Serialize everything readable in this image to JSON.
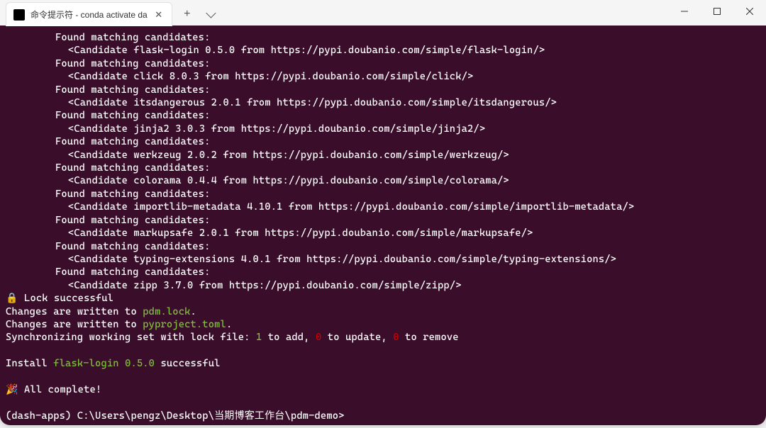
{
  "window": {
    "tab_title": "命令提示符 - conda  activate da",
    "tab_icon_text": "C:\\"
  },
  "terminal": {
    "candidates": [
      {
        "header": "Found matching candidates:",
        "line": "<Candidate flask-login 0.5.0 from https://pypi.doubanio.com/simple/flask-login/>"
      },
      {
        "header": "Found matching candidates:",
        "line": "<Candidate click 8.0.3 from https://pypi.doubanio.com/simple/click/>"
      },
      {
        "header": "Found matching candidates:",
        "line": "<Candidate itsdangerous 2.0.1 from https://pypi.doubanio.com/simple/itsdangerous/>"
      },
      {
        "header": "Found matching candidates:",
        "line": "<Candidate jinja2 3.0.3 from https://pypi.doubanio.com/simple/jinja2/>"
      },
      {
        "header": "Found matching candidates:",
        "line": "<Candidate werkzeug 2.0.2 from https://pypi.doubanio.com/simple/werkzeug/>"
      },
      {
        "header": "Found matching candidates:",
        "line": "<Candidate colorama 0.4.4 from https://pypi.doubanio.com/simple/colorama/>"
      },
      {
        "header": "Found matching candidates:",
        "line": "<Candidate importlib-metadata 4.10.1 from https://pypi.doubanio.com/simple/importlib-metadata/>"
      },
      {
        "header": "Found matching candidates:",
        "line": "<Candidate markupsafe 2.0.1 from https://pypi.doubanio.com/simple/markupsafe/>"
      },
      {
        "header": "Found matching candidates:",
        "line": "<Candidate typing-extensions 4.0.1 from https://pypi.doubanio.com/simple/typing-extensions/>"
      },
      {
        "header": "Found matching candidates:",
        "line": "<Candidate zipp 3.7.0 from https://pypi.doubanio.com/simple/zipp/>"
      }
    ],
    "lock_line": {
      "icon": "🔒",
      "text": "Lock successful"
    },
    "changes1": {
      "prefix": "Changes are written to ",
      "file": "pdm.lock",
      "suffix": "."
    },
    "changes2": {
      "prefix": "Changes are written to ",
      "file": "pyproject.toml",
      "suffix": "."
    },
    "sync": {
      "prefix": "Synchronizing working set with lock file: ",
      "add_n": "1",
      "add_t": " to add, ",
      "upd_n": "0",
      "upd_t": " to update, ",
      "rem_n": "0",
      "rem_t": " to remove"
    },
    "install": {
      "prefix": "Install ",
      "pkg": "flask-login 0.5.0",
      "suffix": " successful"
    },
    "complete": {
      "icon": "🎉",
      "text": "All complete!"
    },
    "prompt": "(dash-apps) C:\\Users\\pengz\\Desktop\\当期博客工作台\\pdm-demo>"
  }
}
